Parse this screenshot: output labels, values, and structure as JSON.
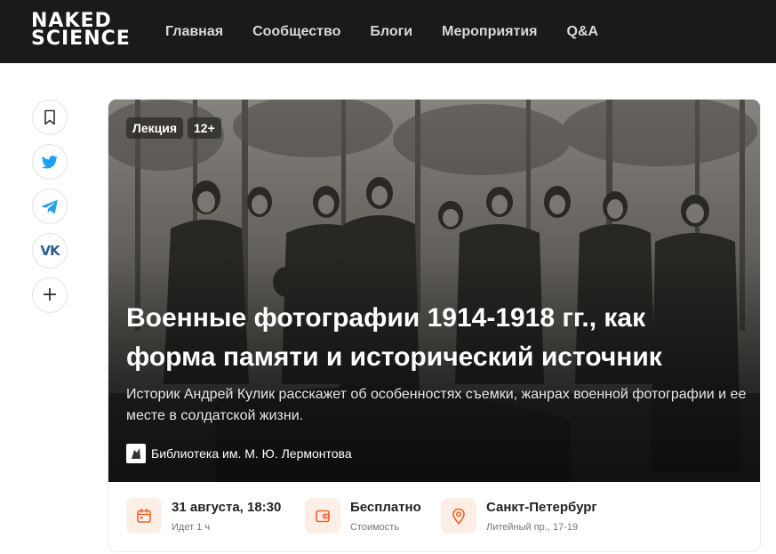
{
  "header": {
    "logo_top": "NAKED",
    "logo_bottom": "SCIENCE",
    "nav": [
      "Главная",
      "Сообщество",
      "Блоги",
      "Мероприятия",
      "Q&A"
    ]
  },
  "share": {
    "buttons": [
      "bookmark-icon",
      "twitter-icon",
      "telegram-icon",
      "vk-icon",
      "plus-icon"
    ],
    "vk_label": "VK",
    "plus_label": "+"
  },
  "event": {
    "tags": [
      "Лекция",
      "12+"
    ],
    "title": "Военные фотографии 1914-1918 гг., как форма памяти и исторический источник",
    "subtitle": "Историк Андрей Кулик расскажет об особенностях съемки, жанрах военной фотографии и ее месте в солдатской жизни.",
    "organizer": "Библиотека им. М. Ю. Лермонтова",
    "date": "31 августа, 18:30",
    "duration": "Идет 1 ч",
    "price": "Бесплатно",
    "price_label": "Стоимость",
    "city": "Санкт-Петербург",
    "address": "Литейный пр., 17-19"
  },
  "colors": {
    "header_bg": "#1a1a1a",
    "accent": "#f0622a",
    "icon_bg": "#fdeee6",
    "twitter": "#1da1f2",
    "telegram": "#2aa3df",
    "vk": "#2c5f93"
  }
}
